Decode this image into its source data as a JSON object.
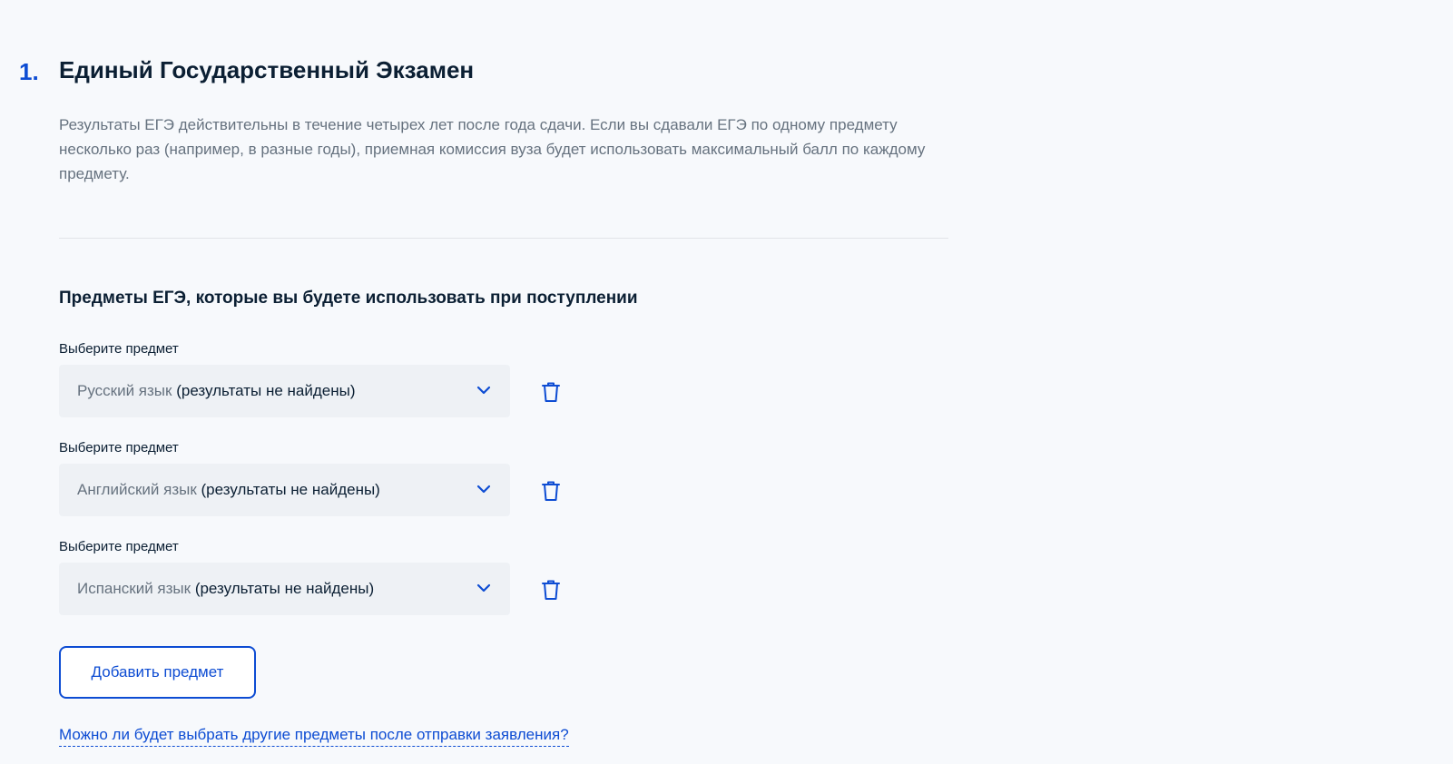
{
  "step": {
    "number": "1.",
    "title": "Единый Государственный Экзамен"
  },
  "description": "Результаты ЕГЭ действительны в течение четырех лет после года сдачи. Если вы сдавали ЕГЭ по одному предмету несколько раз (например, в разные годы), приемная комиссия вуза будет использовать максимальный балл по каждому предмету.",
  "subjects_section": {
    "title": "Предметы ЕГЭ, которые вы будете использовать при поступлении",
    "fields": [
      {
        "label": "Выберите предмет",
        "subject": "Русский язык",
        "status": "(результаты не найдены)"
      },
      {
        "label": "Выберите предмет",
        "subject": "Английский язык",
        "status": "(результаты не найдены)"
      },
      {
        "label": "Выберите предмет",
        "subject": "Испанский язык",
        "status": "(результаты не найдены)"
      }
    ],
    "add_button_label": "Добавить предмет",
    "help_link": "Можно ли будет выбрать другие предметы после отправки заявления?"
  },
  "colors": {
    "accent": "#0d4cd3",
    "text": "#0b1f33",
    "muted_text": "#66727f",
    "background": "#f7f9fc",
    "field_background": "#eef1f5"
  },
  "icons": {
    "dropdown": "chevron-down-icon",
    "delete": "trash-icon"
  }
}
